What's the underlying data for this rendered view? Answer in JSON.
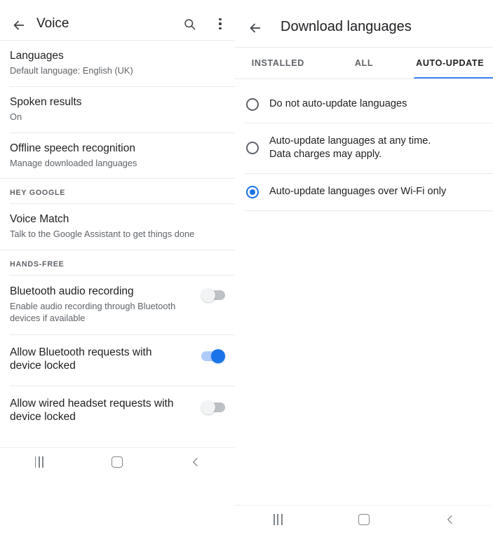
{
  "status_bar": {
    "left_glyphs": "▪ ▪▪ ▪",
    "right_glyphs": "▪▪ ▪▪"
  },
  "left_panel": {
    "appbar": {
      "back_icon": "back-arrow-icon",
      "title": "Voice",
      "search_icon": "search-icon",
      "overflow_icon": "more-vert-icon"
    },
    "items": [
      {
        "title": "Languages",
        "subtitle": "Default language: English (UK)",
        "type": "nav"
      },
      {
        "title": "Spoken results",
        "subtitle": "On",
        "type": "nav"
      },
      {
        "title": "Offline speech recognition",
        "subtitle": "Manage downloaded languages",
        "type": "nav"
      }
    ],
    "section_hey_google": {
      "header": "HEY GOOGLE",
      "items": [
        {
          "title": "Voice Match",
          "subtitle": "Talk to the Google Assistant to get things done",
          "type": "nav"
        }
      ]
    },
    "section_hands_free": {
      "header": "HANDS-FREE",
      "items": [
        {
          "title": "Bluetooth audio recording",
          "subtitle": "Enable audio recording through Bluetooth devices if available",
          "type": "switch",
          "checked": false
        },
        {
          "title": "Allow Bluetooth requests with device locked",
          "subtitle": "",
          "type": "switch",
          "checked": true
        },
        {
          "title": "Allow wired headset requests with device locked",
          "subtitle": "",
          "type": "switch",
          "checked": false
        }
      ]
    },
    "navbar": {
      "recents": "recents-icon",
      "home": "home-icon",
      "back": "back-icon"
    }
  },
  "right_panel": {
    "appbar": {
      "back_icon": "back-arrow-icon",
      "title": "Download languages"
    },
    "tabs": [
      {
        "label": "INSTALLED",
        "active": false
      },
      {
        "label": "ALL",
        "active": false
      },
      {
        "label": "AUTO-UPDATE",
        "active": true
      }
    ],
    "radio_options": [
      {
        "label": "Do not auto-update languages",
        "checked": false
      },
      {
        "label": "Auto-update languages at any time.\nData charges may apply.",
        "checked": false
      },
      {
        "label": "Auto-update languages over Wi-Fi only",
        "checked": true
      }
    ],
    "navbar": {
      "recents": "recents-icon",
      "home": "home-icon",
      "back": "back-icon"
    }
  },
  "colors": {
    "accent_blue": "#1a73e8",
    "tab_indicator": "#4285f4",
    "text_primary": "#202124",
    "text_secondary": "#5f6368",
    "divider": "#e8eaed"
  }
}
